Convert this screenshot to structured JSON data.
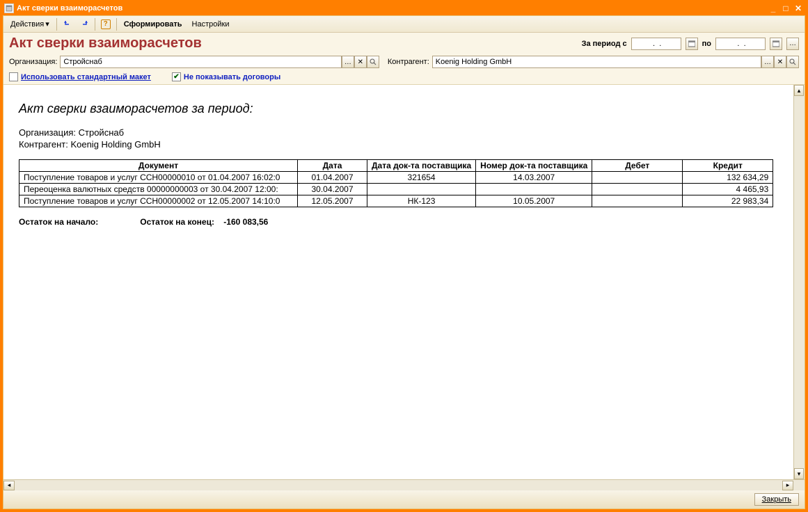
{
  "window": {
    "title": "Акт сверки взаиморасчетов"
  },
  "toolbar": {
    "actions": "Действия",
    "form": "Сформировать",
    "settings": "Настройки"
  },
  "header": {
    "title": "Акт сверки взаиморасчетов",
    "period_label": "За период с",
    "date_from": " .  .",
    "to_label": "по",
    "date_to": " .  ."
  },
  "filters": {
    "org_label": "Организация:",
    "org_value": "Стройснаб",
    "counter_label": "Контрагент:",
    "counter_value": "Koenig Holding GmbH"
  },
  "options": {
    "use_std_layout": {
      "label": "Использовать стандартный макет",
      "checked": false
    },
    "hide_contracts": {
      "label": "Не показывать договоры",
      "checked": true
    }
  },
  "report": {
    "title": "Акт сверки взаиморасчетов за период:",
    "org_line": "Организация: Стройснаб",
    "counter_line": "Контрагент: Koenig Holding GmbH",
    "columns": [
      "Документ",
      "Дата",
      "Дата док-та поставщика",
      "Номер док-та поставщика",
      "Дебет",
      "Кредит"
    ],
    "rows": [
      {
        "doc": "Поступление товаров и услуг ССН00000010 от 01.04.2007 16:02:0",
        "date": "01.04.2007",
        "sup_date": "321654",
        "sup_num": "14.03.2007",
        "debit": "",
        "credit": "132 634,29"
      },
      {
        "doc": "Переоценка валютных средств 00000000003 от 30.04.2007 12:00:",
        "date": "30.04.2007",
        "sup_date": "",
        "sup_num": "",
        "debit": "",
        "credit": "4 465,93"
      },
      {
        "doc": "Поступление товаров и услуг ССН00000002 от 12.05.2007 14:10:0",
        "date": "12.05.2007",
        "sup_date": "НК-123",
        "sup_num": "10.05.2007",
        "debit": "",
        "credit": "22 983,34"
      }
    ],
    "balance_start_label": "Остаток на начало:",
    "balance_end_label": "Остаток на конец:",
    "balance_end_value": "-160 083,56"
  },
  "footer": {
    "close": "Закрыть"
  }
}
